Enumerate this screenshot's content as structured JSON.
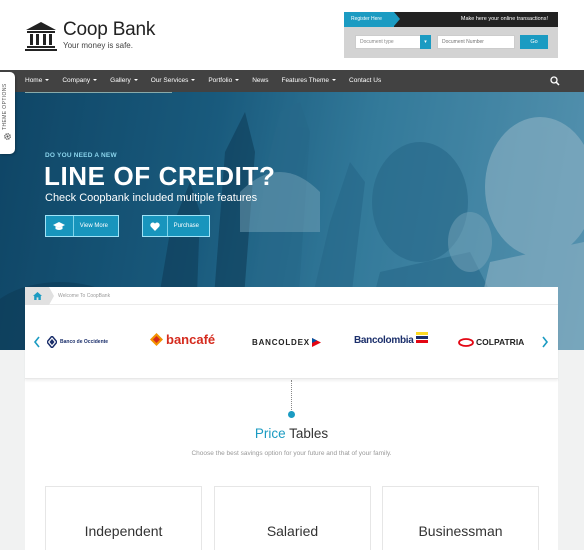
{
  "header": {
    "logo_title": "Coop Bank",
    "logo_tagline": "Your money is safe.",
    "register_label": "Register Here",
    "transaction_message": "Make here your online transactions!",
    "document_type_placeholder": "Document type",
    "document_number_placeholder": "Document Number",
    "go_label": "Go"
  },
  "nav": {
    "items": [
      {
        "label": "Home",
        "dropdown": true
      },
      {
        "label": "Company",
        "dropdown": true
      },
      {
        "label": "Gallery",
        "dropdown": true
      },
      {
        "label": "Our Services",
        "dropdown": true
      },
      {
        "label": "Portfolio",
        "dropdown": true
      },
      {
        "label": "News",
        "dropdown": false
      },
      {
        "label": "Features Theme",
        "dropdown": true
      },
      {
        "label": "Contact Us",
        "dropdown": false
      }
    ],
    "search_icon": "search-icon"
  },
  "theme_options": {
    "label": "THEME OPTIONS",
    "icon": "gear-icon"
  },
  "hero": {
    "kicker": "DO YOU NEED A NEW",
    "title": "LINE OF CREDIT?",
    "subtitle": "Check Coopbank included multiple features",
    "buttons": [
      {
        "label": "View More",
        "icon": "graduation-cap-icon"
      },
      {
        "label": "Purchase",
        "icon": "heart-icon"
      }
    ]
  },
  "breadcrumb": {
    "home_icon": "home-icon",
    "text": "Welcome To CoopBank"
  },
  "partners": {
    "banks": [
      "Banco de Occidente",
      "bancafé",
      "BANCOLDEX",
      "Bancolombia",
      "COLPATRIA"
    ]
  },
  "price_tables": {
    "title_accent": "Price",
    "title_rest": " Tables",
    "description": "Choose the best savings option for your future and that of your family.",
    "plans": [
      "Independent",
      "Salaried",
      "Businessman"
    ]
  },
  "colors": {
    "accent": "#1b9bc2",
    "nav_bg": "#424242",
    "header_bg": "#ffffff"
  }
}
